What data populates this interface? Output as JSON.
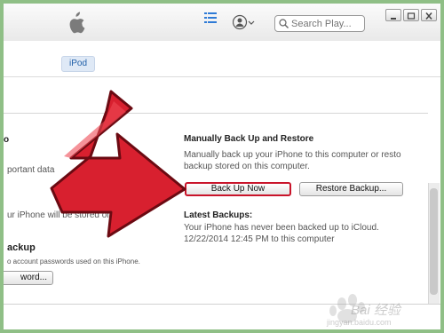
{
  "toolbar": {
    "search_placeholder": "Search Play...",
    "icons": [
      "apple-icon",
      "list-icon",
      "user-icon",
      "search-icon",
      "minimize-icon",
      "restore-icon",
      "close-icon"
    ]
  },
  "tabs": {
    "device_label": "iPod"
  },
  "left_panel": {
    "title_fragment": "o",
    "desc_fragment": "portant data",
    "stored_text": "ur iPhone will be stored on this",
    "backup_label": "ackup",
    "account_text": "o account passwords used on this iPhone.",
    "password_button": "word..."
  },
  "backup": {
    "heading": "Manually Back Up and Restore",
    "description_line1": "Manually back up your iPhone to this computer or resto",
    "description_line2": "backup stored on this computer.",
    "back_up_now_label": "Back Up Now",
    "restore_label": "Restore Backup...",
    "latest_heading": "Latest Backups:",
    "latest_line1": "Your iPhone has never been backed up to iCloud.",
    "latest_line2": "12/22/2014 12:45 PM to this computer"
  },
  "colors": {
    "arrow_fill": "#d8202f",
    "arrow_outline": "#6b0a12",
    "highlight_border": "#c9142a",
    "frame": "#8fbf86",
    "tab_active_bg": "#dfe9f6",
    "tab_active_text": "#1f5fa8"
  },
  "watermark": {
    "text": "Bai 经验",
    "url": "jingyan.baidu.com"
  }
}
